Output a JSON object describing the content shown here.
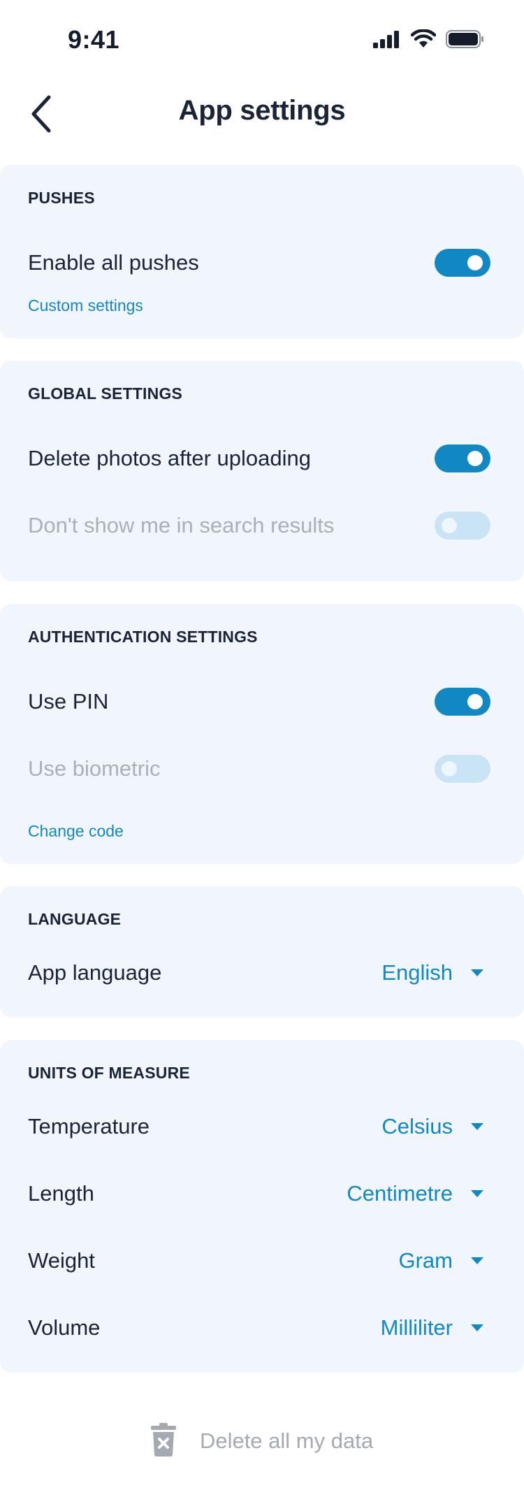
{
  "status_bar": {
    "time": "9:41"
  },
  "header": {
    "title": "App settings"
  },
  "pushes": {
    "title": "PUSHES",
    "enable_all": {
      "label": "Enable all pushes",
      "on": true
    },
    "custom_settings_link": "Custom settings"
  },
  "global_settings": {
    "title": "GLOBAL SETTINGS",
    "delete_photos": {
      "label": "Delete photos after uploading",
      "on": true
    },
    "hide_in_search": {
      "label": "Don't show me in search results",
      "on": false,
      "disabled": true
    }
  },
  "authentication": {
    "title": "AUTHENTICATION SETTINGS",
    "use_pin": {
      "label": "Use PIN",
      "on": true
    },
    "use_biometric": {
      "label": "Use biometric",
      "on": false,
      "disabled": true
    },
    "change_code_link": "Change code"
  },
  "language": {
    "title": "LANGUAGE",
    "app_language": {
      "label": "App language",
      "value": "English"
    }
  },
  "units": {
    "title": "UNITS OF MEASURE",
    "rows": [
      {
        "label": "Temperature",
        "value": "Celsius"
      },
      {
        "label": "Length",
        "value": "Centimetre"
      },
      {
        "label": "Weight",
        "value": "Gram"
      },
      {
        "label": "Volume",
        "value": "Milliliter"
      }
    ]
  },
  "footer": {
    "delete_all_label": "Delete all my data"
  },
  "colors": {
    "accent": "#1288c3",
    "card_background": "#f1f6fd",
    "text_primary": "#1b2437",
    "text_disabled": "#abb0b8",
    "toggle_off": "#c9e4f5"
  },
  "icons": {
    "back": "chevron-left-icon",
    "signal": "cellular-signal-icon",
    "wifi": "wifi-icon",
    "battery": "battery-icon",
    "dropdown": "caret-down-icon",
    "delete": "trash-icon"
  }
}
